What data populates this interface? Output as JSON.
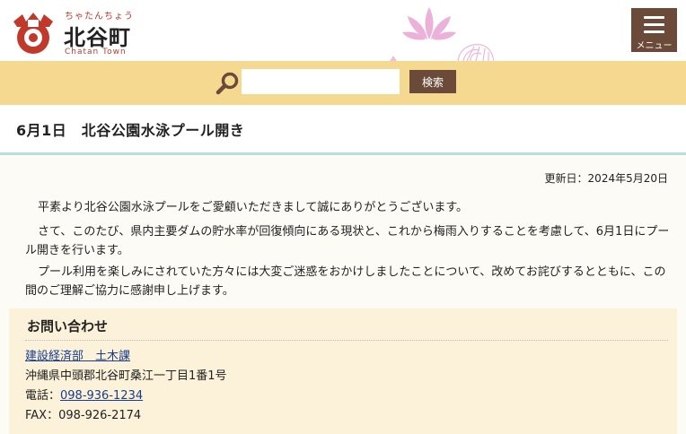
{
  "header": {
    "logo_kana": "ちゃたんちょう",
    "logo_name": "北谷町",
    "logo_en": "Chatan Town",
    "menu_label": "メニュー",
    "accent_color": "#6b4a3a",
    "logo_color": "#c0392b"
  },
  "search": {
    "placeholder": "",
    "value": "",
    "button_label": "検索",
    "bar_color": "#f5d990"
  },
  "article": {
    "title": "6月1日　北谷公園水泳プール開き",
    "updated": "更新日：2024年5月20日",
    "paragraphs": [
      "平素より北谷公園水泳プールをご愛顧いただきまして誠にありがとうございます。",
      "さて、このたび、県内主要ダムの貯水率が回復傾向にある現状と、これから梅雨入りすることを考慮して、6月1日にプール開きを行います。",
      "プール利用を楽しみにされていた方々には大変ご迷惑をおかけしましたことについて、改めてお詫びするとともに、この間のご理解ご協力に感謝申し上げます。"
    ]
  },
  "contact": {
    "heading": "お問い合わせ",
    "department": "建設経済部　土木課",
    "address": "沖縄県中頭郡北谷町桑江一丁目1番1号",
    "tel_label": "電話：",
    "tel": "098-936-1234",
    "fax": "FAX：098-926-2174"
  }
}
